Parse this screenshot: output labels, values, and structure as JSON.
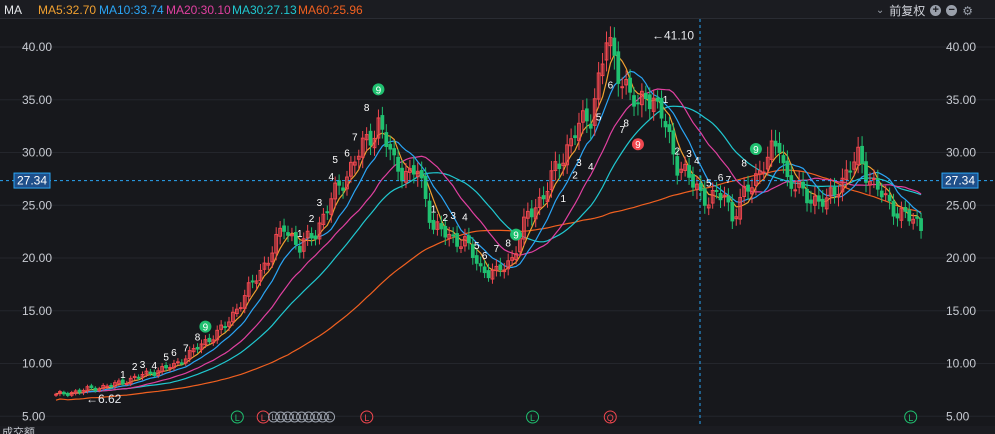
{
  "indicators": {
    "name": "MA",
    "ma5": {
      "label": "MA5:32.70",
      "color": "#f0a030"
    },
    "ma10": {
      "label": "MA10:33.74",
      "color": "#2aa5f5"
    },
    "ma20": {
      "label": "MA20:30.10",
      "color": "#e040a0"
    },
    "ma30": {
      "label": "MA30:27.13",
      "color": "#20c8d0"
    },
    "ma60": {
      "label": "MA60:25.96",
      "color": "#f06020"
    }
  },
  "toolbar": {
    "adjust_label": "前复权",
    "chevron_icon": "chevron-down-icon",
    "zoom_in_icon": "plus-circle-icon",
    "zoom_out_icon": "minus-circle-icon",
    "settings_icon": "gear-icon"
  },
  "crosshair": {
    "price_label": "27.34",
    "price": 27.34
  },
  "annotations": {
    "high_label": "←41.10",
    "high": 41.1,
    "low_label": "←6.62",
    "low": 6.62
  },
  "bottom": {
    "volume_label": "成交额"
  },
  "colors": {
    "up": "#f0474f",
    "down": "#20c070",
    "background": "#17181c",
    "grid": "#24262c",
    "text": "#c8cbd2",
    "crosshair": "#2aa5f5"
  },
  "chart_data": {
    "type": "candlestick",
    "ylim": [
      5,
      42
    ],
    "y_ticks": [
      "40.00",
      "35.00",
      "30.00",
      "25.00",
      "20.00",
      "15.00",
      "10.00",
      "5.00"
    ],
    "tick_values": [
      40,
      35,
      30,
      25,
      20,
      15,
      10,
      5
    ],
    "grid": true,
    "series_names": [
      "MA5",
      "MA10",
      "MA20",
      "MA30",
      "MA60"
    ],
    "counts": [
      {
        "i": 13,
        "t": "1",
        "c": "#ffffff"
      },
      {
        "i": 15,
        "t": "2",
        "c": "#ffffff"
      },
      {
        "i": 17,
        "t": "3",
        "c": "#ffffff"
      },
      {
        "i": 19,
        "t": "4",
        "c": "#ffffff"
      },
      {
        "i": 21,
        "t": "5",
        "c": "#ffffff"
      },
      {
        "i": 23,
        "t": "6",
        "c": "#ffffff"
      },
      {
        "i": 25,
        "t": "7",
        "c": "#ffffff"
      },
      {
        "i": 27,
        "t": "8",
        "c": "#ffffff"
      },
      {
        "i": 29,
        "t": "9",
        "c": "#20c070",
        "badge": true
      },
      {
        "i": 47,
        "t": "1",
        "c": "#ffffff"
      },
      {
        "i": 49,
        "t": "2",
        "c": "#ffffff"
      },
      {
        "i": 51,
        "t": "3",
        "c": "#ffffff"
      },
      {
        "i": 53,
        "t": "4",
        "c": "#ffffff"
      },
      {
        "i": 54,
        "t": "5",
        "c": "#ffffff"
      },
      {
        "i": 56,
        "t": "6",
        "c": "#ffffff"
      },
      {
        "i": 58,
        "t": "7",
        "c": "#ffffff"
      },
      {
        "i": 60,
        "t": "8",
        "c": "#ffffff"
      },
      {
        "i": 62,
        "t": "9",
        "c": "#20c070",
        "badge": true
      },
      {
        "i": 73,
        "t": "1",
        "c": "#ffffff"
      },
      {
        "i": 75,
        "t": "2",
        "c": "#ffffff"
      },
      {
        "i": 77,
        "t": "3",
        "c": "#ffffff"
      },
      {
        "i": 79,
        "t": "4",
        "c": "#ffffff"
      },
      {
        "i": 81,
        "t": "5",
        "c": "#ffffff"
      },
      {
        "i": 83,
        "t": "6",
        "c": "#ffffff"
      },
      {
        "i": 85,
        "t": "7",
        "c": "#ffffff"
      },
      {
        "i": 87,
        "t": "8",
        "c": "#ffffff"
      },
      {
        "i": 89,
        "t": "9",
        "c": "#20c070",
        "badge": true
      },
      {
        "i": 98,
        "t": "1",
        "c": "#ffffff"
      },
      {
        "i": 100,
        "t": "2",
        "c": "#ffffff"
      },
      {
        "i": 101,
        "t": "3",
        "c": "#ffffff"
      },
      {
        "i": 103,
        "t": "4",
        "c": "#ffffff"
      },
      {
        "i": 105,
        "t": "5",
        "c": "#ffffff"
      },
      {
        "i": 107,
        "t": "6",
        "c": "#ffffff"
      },
      {
        "i": 109,
        "t": "7",
        "c": "#ffffff"
      },
      {
        "i": 110,
        "t": "8",
        "c": "#ffffff"
      },
      {
        "i": 112,
        "t": "9",
        "c": "#f0474f",
        "badge": true
      },
      {
        "i": 118,
        "t": "1",
        "c": "#ffffff"
      },
      {
        "i": 120,
        "t": "2",
        "c": "#ffffff"
      },
      {
        "i": 122,
        "t": "3",
        "c": "#ffffff"
      },
      {
        "i": 124,
        "t": "4",
        "c": "#ffffff"
      },
      {
        "i": 126,
        "t": "5",
        "c": "#ffffff"
      },
      {
        "i": 128,
        "t": "6",
        "c": "#ffffff"
      },
      {
        "i": 130,
        "t": "7",
        "c": "#ffffff"
      },
      {
        "i": 133,
        "t": "8",
        "c": "#ffffff"
      },
      {
        "i": 135,
        "t": "9",
        "c": "#20c070",
        "badge": true
      }
    ],
    "markers": [
      {
        "i": 35,
        "t": "L",
        "c": "#20c070"
      },
      {
        "i": 40,
        "t": "L",
        "c": "#f0474f"
      },
      {
        "i": 42,
        "t": "LLLLLLLLL",
        "c": "#9aa0ab"
      },
      {
        "i": 60,
        "t": "L",
        "c": "#f0474f"
      },
      {
        "i": 92,
        "t": "L",
        "c": "#20c070"
      },
      {
        "i": 107,
        "t": "Q",
        "c": "#f0474f"
      },
      {
        "i": 165,
        "t": "L",
        "c": "#20c070"
      }
    ]
  }
}
